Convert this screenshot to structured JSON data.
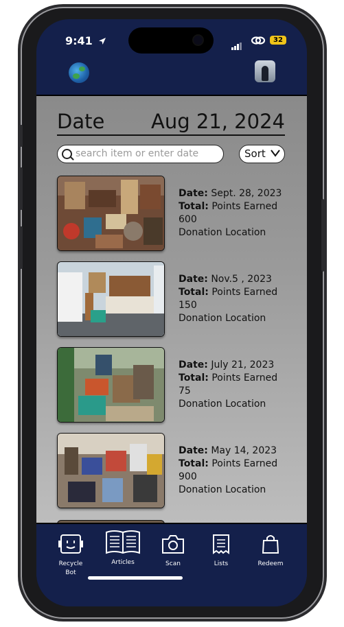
{
  "status_bar": {
    "time": "9:41",
    "battery": "32"
  },
  "header": {
    "date_label": "Date",
    "date_value": "Aug 21, 2024"
  },
  "search": {
    "placeholder": "search item or enter date"
  },
  "sort": {
    "label": "Sort"
  },
  "entries": [
    {
      "date_label": "Date:",
      "date": "Sept. 28, 2023",
      "total_label": "Total:",
      "total_text": "Points Earned",
      "points": "600",
      "location": "Donation Location"
    },
    {
      "date_label": "Date:",
      "date": "Nov.5 , 2023",
      "total_label": "Total:",
      "total_text": "Points Earned",
      "points": "150",
      "location": "Donation Location"
    },
    {
      "date_label": "Date:",
      "date": "July 21, 2023",
      "total_label": "Total:",
      "total_text": "Points Earned",
      "points": "75",
      "location": "Donation Location"
    },
    {
      "date_label": "Date:",
      "date": "May 14, 2023",
      "total_label": "Total:",
      "total_text": "Points Earned",
      "points": "900",
      "location": "Donation Location"
    }
  ],
  "nav": {
    "recycle_bot": "Recycle\nBot",
    "articles": "Articles",
    "scan": "Scan",
    "lists": "Lists",
    "redeem": "Redeem"
  },
  "icons": {
    "location": "location-arrow-icon",
    "link": "link-icon",
    "recycle_bot": "robot-icon",
    "articles": "book-icon",
    "scan": "camera-icon",
    "lists": "receipt-icon",
    "redeem": "shopping-bag-icon"
  },
  "colors": {
    "navy": "#14204b",
    "battery": "#f0c419",
    "content_gray": "#9a9a9a"
  }
}
